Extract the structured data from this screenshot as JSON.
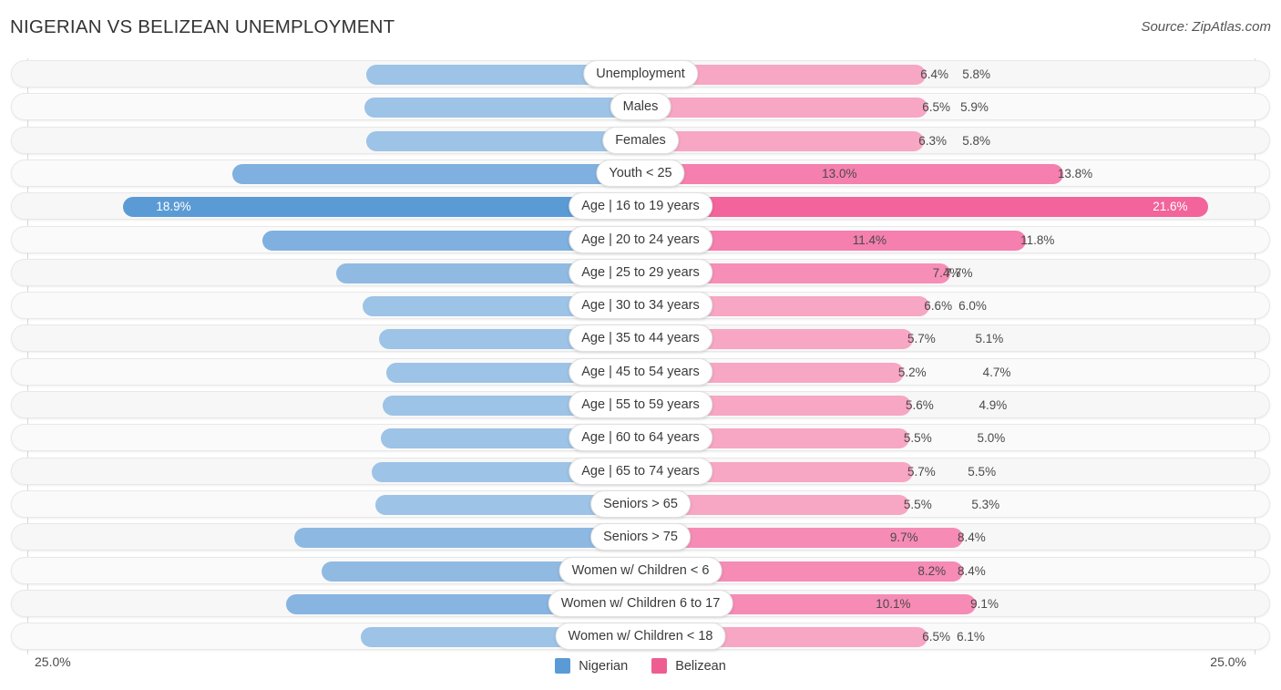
{
  "header": {
    "title": "NIGERIAN VS BELIZEAN UNEMPLOYMENT",
    "source": "Source: ZipAtlas.com"
  },
  "footer": {
    "axis_left": "25.0%",
    "axis_right": "25.0%"
  },
  "legend": {
    "items": [
      {
        "label": "Nigerian",
        "color": "#5B9BD5",
        "icon": "square-swatch"
      },
      {
        "label": "Belizean",
        "color": "#EE5D92",
        "icon": "square-swatch"
      }
    ]
  },
  "chart_data": {
    "type": "bar",
    "orientation": "horizontal-diverging",
    "title": "NIGERIAN VS BELIZEAN UNEMPLOYMENT",
    "xlabel": "",
    "ylabel": "",
    "xlim": [
      25.0,
      25.0
    ],
    "axis_ticks": [
      "25.0%",
      "25.0%"
    ],
    "grid": false,
    "legend_position": "bottom-center",
    "unit": "%",
    "categories": [
      "Unemployment",
      "Males",
      "Females",
      "Youth < 25",
      "Age | 16 to 19 years",
      "Age | 20 to 24 years",
      "Age | 25 to 29 years",
      "Age | 30 to 34 years",
      "Age | 35 to 44 years",
      "Age | 45 to 54 years",
      "Age | 55 to 59 years",
      "Age | 60 to 64 years",
      "Age | 65 to 74 years",
      "Seniors > 65",
      "Seniors > 75",
      "Women w/ Children < 6",
      "Women w/ Children 6 to 17",
      "Women w/ Children < 18"
    ],
    "series": [
      {
        "name": "Nigerian",
        "color": "#5B9BD5",
        "values": [
          5.8,
          5.9,
          5.8,
          13.0,
          18.9,
          11.4,
          7.4,
          6.0,
          5.1,
          4.7,
          4.9,
          5.0,
          5.5,
          5.3,
          9.7,
          8.2,
          10.1,
          6.1
        ]
      },
      {
        "name": "Belizean",
        "color": "#EE5D92",
        "values": [
          6.4,
          6.5,
          6.3,
          13.8,
          21.6,
          11.8,
          7.7,
          6.6,
          5.7,
          5.2,
          5.6,
          5.5,
          5.7,
          5.5,
          8.4,
          8.4,
          9.1,
          6.5
        ]
      }
    ]
  },
  "rows": [
    {
      "label": "Unemployment",
      "left": "5.8%",
      "right": "6.4%",
      "left_val": 5.8,
      "right_val": 6.4,
      "left_color": "#9DC3E6",
      "right_color": "#F7A6C4",
      "inside": false
    },
    {
      "label": "Males",
      "left": "5.9%",
      "right": "6.5%",
      "left_val": 5.9,
      "right_val": 6.5,
      "left_color": "#9DC3E6",
      "right_color": "#F7A6C4",
      "inside": false
    },
    {
      "label": "Females",
      "left": "5.8%",
      "right": "6.3%",
      "left_val": 5.8,
      "right_val": 6.3,
      "left_color": "#9DC3E6",
      "right_color": "#F7A6C4",
      "inside": false
    },
    {
      "label": "Youth < 25",
      "left": "13.0%",
      "right": "13.8%",
      "left_val": 13.0,
      "right_val": 13.8,
      "left_color": "#7FB0E0",
      "right_color": "#F57FAE",
      "inside": false
    },
    {
      "label": "Age | 16 to 19 years",
      "left": "18.9%",
      "right": "21.6%",
      "left_val": 18.9,
      "right_val": 21.6,
      "left_color": "#5B9BD5",
      "right_color": "#F2649B",
      "inside": true
    },
    {
      "label": "Age | 20 to 24 years",
      "left": "11.4%",
      "right": "11.8%",
      "left_val": 11.4,
      "right_val": 11.8,
      "left_color": "#7FB0E0",
      "right_color": "#F57FAE",
      "inside": false
    },
    {
      "label": "Age | 25 to 29 years",
      "left": "7.4%",
      "right": "7.7%",
      "left_val": 7.4,
      "right_val": 7.7,
      "left_color": "#91BAE3",
      "right_color": "#F78EB7",
      "inside": false
    },
    {
      "label": "Age | 30 to 34 years",
      "left": "6.0%",
      "right": "6.6%",
      "left_val": 6.0,
      "right_val": 6.6,
      "left_color": "#9DC3E6",
      "right_color": "#F7A6C4",
      "inside": false
    },
    {
      "label": "Age | 35 to 44 years",
      "left": "5.1%",
      "right": "5.7%",
      "left_val": 5.1,
      "right_val": 5.7,
      "left_color": "#9DC3E6",
      "right_color": "#F7A6C4",
      "inside": false
    },
    {
      "label": "Age | 45 to 54 years",
      "left": "4.7%",
      "right": "5.2%",
      "left_val": 4.7,
      "right_val": 5.2,
      "left_color": "#9DC3E6",
      "right_color": "#F7A6C4",
      "inside": false
    },
    {
      "label": "Age | 55 to 59 years",
      "left": "4.9%",
      "right": "5.6%",
      "left_val": 4.9,
      "right_val": 5.6,
      "left_color": "#9DC3E6",
      "right_color": "#F7A6C4",
      "inside": false
    },
    {
      "label": "Age | 60 to 64 years",
      "left": "5.0%",
      "right": "5.5%",
      "left_val": 5.0,
      "right_val": 5.5,
      "left_color": "#9DC3E6",
      "right_color": "#F7A6C4",
      "inside": false
    },
    {
      "label": "Age | 65 to 74 years",
      "left": "5.5%",
      "right": "5.7%",
      "left_val": 5.5,
      "right_val": 5.7,
      "left_color": "#9DC3E6",
      "right_color": "#F7A6C4",
      "inside": false
    },
    {
      "label": "Seniors > 65",
      "left": "5.3%",
      "right": "5.5%",
      "left_val": 5.3,
      "right_val": 5.5,
      "left_color": "#9DC3E6",
      "right_color": "#F7A6C4",
      "inside": false
    },
    {
      "label": "Seniors > 75",
      "left": "9.7%",
      "right": "8.4%",
      "left_val": 9.7,
      "right_val": 8.4,
      "left_color": "#8DB8E2",
      "right_color": "#F68BB5",
      "inside": false
    },
    {
      "label": "Women w/ Children < 6",
      "left": "8.2%",
      "right": "8.4%",
      "left_val": 8.2,
      "right_val": 8.4,
      "left_color": "#91BAE3",
      "right_color": "#F68BB5",
      "inside": false
    },
    {
      "label": "Women w/ Children 6 to 17",
      "left": "10.1%",
      "right": "9.1%",
      "left_val": 10.1,
      "right_val": 9.1,
      "left_color": "#87B4E1",
      "right_color": "#F68BB5",
      "inside": false
    },
    {
      "label": "Women w/ Children < 18",
      "left": "6.1%",
      "right": "6.5%",
      "left_val": 6.1,
      "right_val": 6.5,
      "left_color": "#9DC3E6",
      "right_color": "#F7A6C4",
      "inside": false
    }
  ]
}
